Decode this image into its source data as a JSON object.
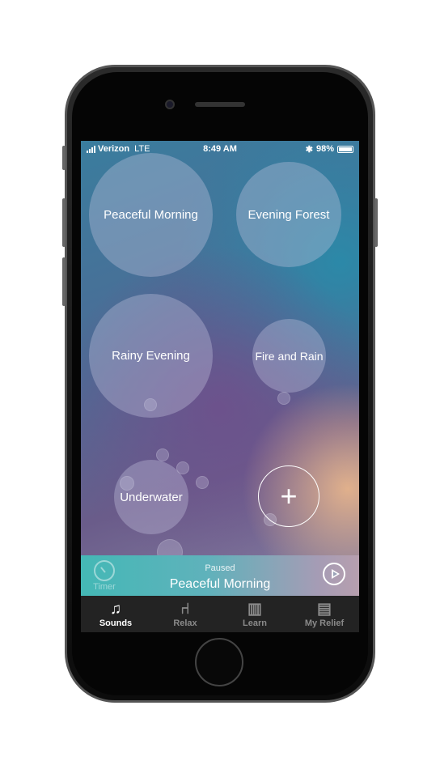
{
  "status": {
    "carrier": "Verizon",
    "network": "LTE",
    "time": "8:49 AM",
    "battery": "98%",
    "battery_level": 0.98,
    "bluetooth_icon": "bluetooth-icon"
  },
  "sounds": [
    {
      "label": "Peaceful Morning"
    },
    {
      "label": "Evening Forest"
    },
    {
      "label": "Rainy Evening"
    },
    {
      "label": "Fire and Rain"
    },
    {
      "label": "Underwater"
    }
  ],
  "add_label": "+",
  "player": {
    "timer_label": "Timer",
    "state": "Paused",
    "title": "Peaceful Morning"
  },
  "tabs": [
    {
      "label": "Sounds",
      "icon": "music-note-icon",
      "glyph": "♫"
    },
    {
      "label": "Relax",
      "icon": "chair-icon",
      "glyph": "⑁"
    },
    {
      "label": "Learn",
      "icon": "book-icon",
      "glyph": "▥"
    },
    {
      "label": "My Relief",
      "icon": "clipboard-icon",
      "glyph": "▤"
    }
  ],
  "colors": {
    "player_start": "#44b8b6",
    "player_end": "#b79fae",
    "tabbar": "#232323"
  }
}
